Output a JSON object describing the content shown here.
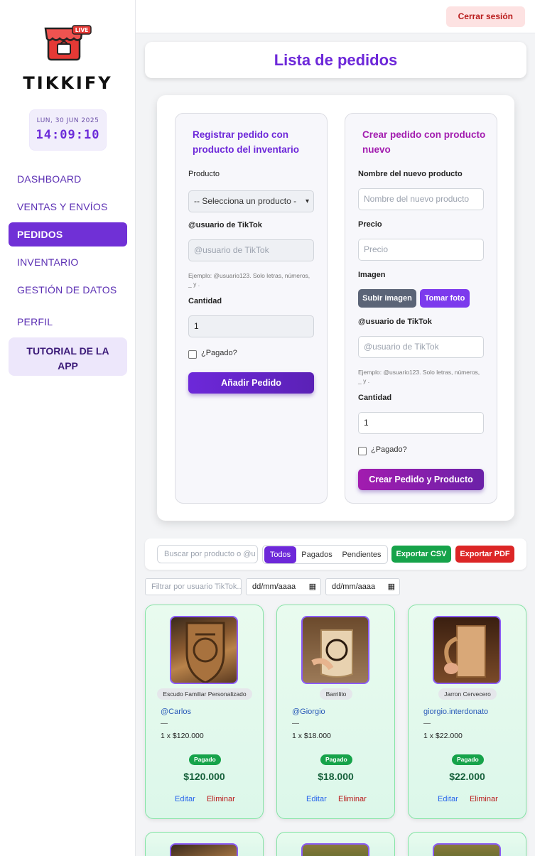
{
  "sidebar": {
    "brand": "TIKKIFY",
    "logo_badge": "LIVE",
    "clock_date": "LUN, 30 JUN 2025",
    "clock_time": "14:09:10",
    "nav": [
      {
        "label": "DASHBOARD"
      },
      {
        "label": "VENTAS Y ENVÍOS"
      },
      {
        "label": "PEDIDOS"
      },
      {
        "label": "INVENTARIO"
      },
      {
        "label": "GESTIÓN DE DATOS"
      },
      {
        "label": "PERFIL"
      }
    ],
    "tutorial_line1": "TUTORIAL DE LA",
    "tutorial_line2": "APP"
  },
  "topbar": {
    "logout_label": "Cerrar sesión"
  },
  "page_title": "Lista de pedidos",
  "form_inventory": {
    "title_line1": "Registrar pedido con",
    "title_line2": "producto del inventario",
    "product_label": "Producto",
    "product_select": "-- Selecciona un producto -",
    "user_label": "@usuario de TikTok",
    "user_placeholder": "@usuario de TikTok",
    "hint_line1": "Ejemplo: @usuario123. Solo letras, números,",
    "hint_line2": "_ y .",
    "qty_label": "Cantidad",
    "qty_value": "1",
    "paid_label": "¿Pagado?",
    "submit_label": "Añadir Pedido"
  },
  "form_new": {
    "title_line1": "Crear pedido con producto",
    "title_line2": "nuevo",
    "name_label": "Nombre del nuevo producto",
    "name_placeholder": "Nombre del nuevo producto",
    "price_label": "Precio",
    "price_placeholder": "Precio",
    "image_label": "Imagen",
    "upload_label": "Subir imagen",
    "photo_label": "Tomar foto",
    "user_label": "@usuario de TikTok",
    "user_placeholder": "@usuario de TikTok",
    "hint_line1": "Ejemplo: @usuario123. Solo letras, números,",
    "hint_line2": "_ y .",
    "qty_label": "Cantidad",
    "qty_value": "1",
    "paid_label": "¿Pagado?",
    "submit_label": "Crear Pedido y Producto"
  },
  "toolbar": {
    "search_placeholder": "Buscar por producto o @u",
    "tab_all": "Todos",
    "tab_paid": "Pagados",
    "tab_pending": "Pendientes",
    "export_csv": "Exportar CSV",
    "export_pdf": "Exportar PDF",
    "user_filter_placeholder": "Filtrar por usuario TikTok...",
    "date_from": "dd/mm/aaaa",
    "date_to": "dd/mm/aaaa"
  },
  "orders": [
    {
      "product": "Escudo Familiar Personalizado",
      "user": "@Carlos",
      "note": "—",
      "qty_price": "1 x $120.000",
      "status": "Pagado",
      "total": "$120.000",
      "edit": "Editar",
      "delete": "Eliminar"
    },
    {
      "product": "Barrilito",
      "user": "@Giorgio",
      "note": "—",
      "qty_price": "1 x $18.000",
      "status": "Pagado",
      "total": "$18.000",
      "edit": "Editar",
      "delete": "Eliminar"
    },
    {
      "product": "Jarron Cervecero",
      "user": "giorgio.interdonato",
      "note": "—",
      "qty_price": "1 x $22.000",
      "status": "Pagado",
      "total": "$22.000",
      "edit": "Editar",
      "delete": "Eliminar"
    }
  ],
  "colors": {
    "accent": "#6d28d9",
    "nav_active": "#7030d6",
    "paid": "#16a34a",
    "csv": "#16a34a",
    "pdf": "#dc2626"
  }
}
